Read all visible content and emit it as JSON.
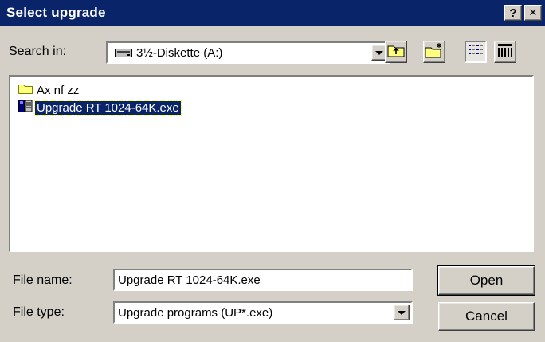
{
  "window": {
    "title": "Select upgrade",
    "help_label": "?",
    "close_label": "✕"
  },
  "search": {
    "label": "Search in:",
    "location": "3½-Diskette (A:)",
    "location_icon": "floppy-drive-icon"
  },
  "toolbar": {
    "up_icon": "up-folder-icon",
    "new_folder_icon": "new-folder-icon",
    "list_view_icon": "list-view-icon",
    "details_view_icon": "details-view-icon"
  },
  "files": [
    {
      "name": "Ax nf zz",
      "icon": "folder-icon",
      "selected": false
    },
    {
      "name": "Upgrade RT 1024-64K.exe",
      "icon": "executable-icon",
      "selected": true
    }
  ],
  "file_name": {
    "label": "File name:",
    "value": "Upgrade RT 1024-64K.exe"
  },
  "file_type": {
    "label": "File type:",
    "value": "Upgrade programs (UP*.exe)"
  },
  "buttons": {
    "open": "Open",
    "cancel": "Cancel"
  },
  "colors": {
    "title_bar": "#0a246a",
    "face": "#d4d0c8",
    "selection": "#0a246a"
  }
}
